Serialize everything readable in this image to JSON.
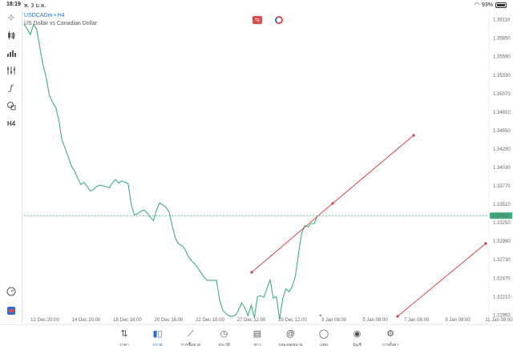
{
  "status_bar": {
    "time": "18:19",
    "date": "พ. 3 ม.ค.",
    "battery": "93%"
  },
  "header": {
    "symbol": "USDCADm • H4",
    "description": "US Dollar vs Canadian Dollar"
  },
  "icons": {
    "left_toolbar": [
      "crosshair-icon",
      "candlestick-icon",
      "bar-chart-icon",
      "indicators-icon",
      "function-icon",
      "shapes-icon",
      "timeframe-icon"
    ],
    "timeframe": "H4"
  },
  "chart_data": {
    "type": "line",
    "symbol": "USDCADm",
    "timeframe": "H4",
    "price_axis": [
      "1.36110",
      "1.35850",
      "1.35590",
      "1.35330",
      "1.35070",
      "1.34810",
      "1.34550",
      "1.34290",
      "1.34030",
      "1.33770",
      "1.33510",
      "1.33250",
      "1.32990",
      "1.32730",
      "1.32470",
      "1.32210",
      "1.31950"
    ],
    "time_axis": [
      "12 Dec 20:00",
      "14 Dec 20:00",
      "18 Dec 16:00",
      "20 Dec 16:00",
      "22 Dec 16:00",
      "27 Dec 12:00",
      "29 Dec 12:00",
      "3 Jan 08:00",
      "5 Jan 08:00",
      "7 Jan 08:00",
      "9 Jan 08:00",
      "11 Jan 08:00"
    ],
    "ylim": [
      1.3183,
      1.3623
    ],
    "current_price": "1.33350",
    "current_price_value": 1.3335,
    "line_color": "#3dae7e",
    "trendline_color": "#d83a3a",
    "series": [
      {
        "values": [
          1.3605,
          1.3598,
          1.359,
          1.3604,
          1.3598,
          1.3572,
          1.3548,
          1.353,
          1.3505,
          1.3495,
          1.3488,
          1.347,
          1.3442,
          1.343,
          1.3418,
          1.3405,
          1.3398,
          1.3388,
          1.3379,
          1.3382,
          1.3376,
          1.337,
          1.3372,
          1.3376,
          1.3378,
          1.3377,
          1.3376,
          1.3374,
          1.3381,
          1.3386,
          1.3381,
          1.3384,
          1.3382,
          1.338,
          1.335,
          1.3336,
          1.3338,
          1.3341,
          1.3343,
          1.3339,
          1.3333,
          1.3328,
          1.3343,
          1.3353,
          1.335,
          1.3347,
          1.334,
          1.332,
          1.3303,
          1.3295,
          1.3293,
          1.3288,
          1.3278,
          1.3272,
          1.3268,
          1.3262,
          1.3255,
          1.3249,
          1.3244,
          1.3244,
          1.3244,
          1.3244,
          1.3216,
          1.3202,
          1.3197,
          1.3194,
          1.3193,
          1.3195,
          1.3202,
          1.3212,
          1.3205,
          1.3194,
          1.3209,
          1.3191,
          1.3221,
          1.3222,
          1.322,
          1.3232,
          1.3245,
          1.3219,
          1.3221,
          1.3189,
          1.3218,
          1.3232,
          1.3228,
          1.3235,
          1.325,
          1.3281,
          1.331,
          1.3321,
          1.3319,
          1.3324,
          1.3324,
          1.3335
        ]
      }
    ]
  },
  "bottom_nav": [
    {
      "label": "ราคา",
      "icon": "quotes-icon"
    },
    {
      "label": "กราฟ",
      "icon": "chart-icon",
      "active": true
    },
    {
      "label": "การซื้อขาย",
      "icon": "trade-icon"
    },
    {
      "label": "ประวัติ",
      "icon": "history-icon"
    },
    {
      "label": "ข่าว",
      "icon": "news-icon"
    },
    {
      "label": "กล่องจดหมาย",
      "icon": "mailbox-icon"
    },
    {
      "label": "แชท",
      "icon": "chat-icon"
    },
    {
      "label": "บัญชี",
      "icon": "account-icon"
    },
    {
      "label": "การตั้งค่า",
      "icon": "settings-icon"
    }
  ]
}
